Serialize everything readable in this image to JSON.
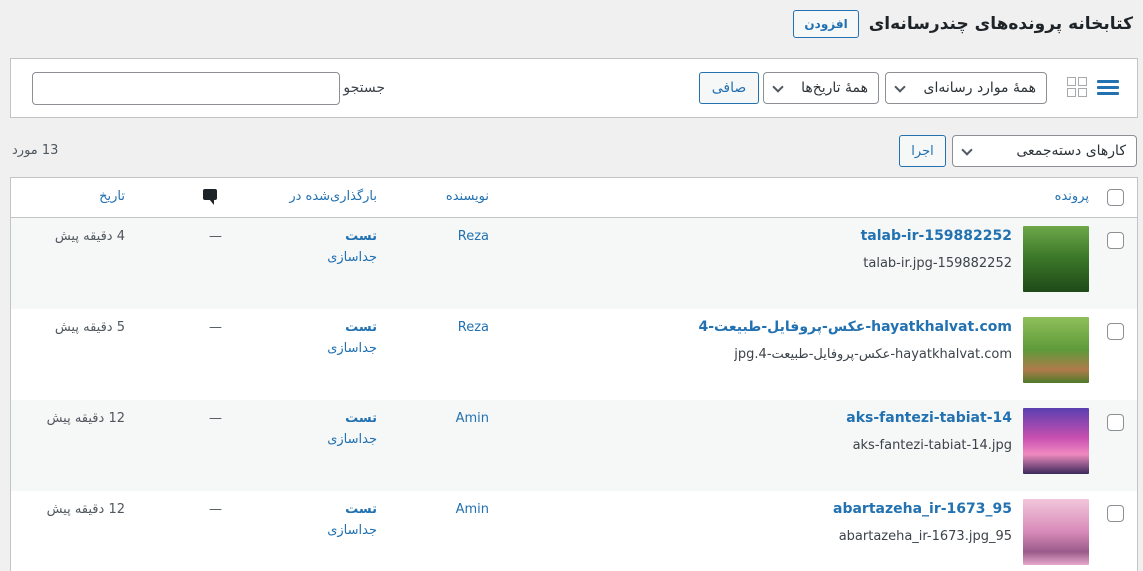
{
  "header": {
    "title": "کتابخانه پرونده‌های چندرسانه‌ای",
    "add_new": "افزودن"
  },
  "toolbar": {
    "media_type": "همهٔ موارد رسانه‌ای",
    "dates": "همهٔ تاریخ‌ها",
    "filter": "صافی",
    "search_label": "جستجو",
    "search_value": ""
  },
  "bulk": {
    "action": "کارهای دسته‌جمعی",
    "apply": "اجرا"
  },
  "count": "13 مورد",
  "columns": {
    "file": "پرونده",
    "author": "نویسنده",
    "uploaded_to": "بارگذاری‌شده در",
    "date": "تاریخ"
  },
  "rows": [
    {
      "title": "talab-ir-159882252",
      "filename": "talab-ir.jpg-159882252",
      "author": "Reza",
      "attached": "تست",
      "detach": "جداسازی",
      "comments": "—",
      "date": "4 دقیقه پیش",
      "thumb": "forest-path"
    },
    {
      "title": "hayatkhalvat.com-عکس-پروفایل-طبیعت-4",
      "filename": "hayatkhalvat.com-عکس-پروفایل-طبیعت-4.jpg",
      "author": "Reza",
      "attached": "تست",
      "detach": "جداسازی",
      "comments": "—",
      "date": "5 دقیقه پیش",
      "thumb": "tree-alley"
    },
    {
      "title": "aks-fantezi-tabiat-14",
      "filename": "aks-fantezi-tabiat-14.jpg",
      "author": "Amin",
      "attached": "تست",
      "detach": "جداسازی",
      "comments": "—",
      "date": "12 دقیقه پیش",
      "thumb": "fantasy-sky"
    },
    {
      "title": "abartazeha_ir-1673_95",
      "filename": "abartazeha_ir-1673.jpg_95",
      "author": "Amin",
      "attached": "تست",
      "detach": "جداسازی",
      "comments": "—",
      "date": "12 دقیقه پیش",
      "thumb": "pink-trees"
    }
  ]
}
